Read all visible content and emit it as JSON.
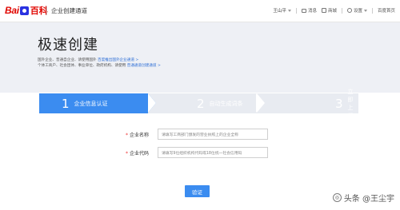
{
  "topbar": {
    "logo_text_bai": "Bai",
    "logo_text_du": "百科",
    "title": "企业创建通道",
    "user": "王山平",
    "links": [
      {
        "label": "消息",
        "icon": "message-icon"
      },
      {
        "label": "商城",
        "icon": "shop-icon"
      },
      {
        "label": "设置",
        "icon": "gear-icon"
      },
      {
        "label": "百度首页"
      }
    ]
  },
  "hero": {
    "title": "极速创建",
    "line1_text": "国外企业、普通自企业、请使用国外",
    "line1_link": "百度推出国外企业通道 >",
    "line2_text": "个体工商户、社会团体、事业单位、政府机构、请使用",
    "line2_link": "普通通道创建通道 >"
  },
  "steps": [
    {
      "num": "1",
      "label": "企业信息认证",
      "active": true
    },
    {
      "num": "2",
      "label": "自动生成词条",
      "active": false
    },
    {
      "num": "3",
      "label": "立即上线",
      "active": false
    }
  ],
  "form": {
    "name_label": "企业名称",
    "name_placeholder": "请填写工商部门颁发的营业执照上的企业全称",
    "code_label": "企业代码",
    "code_placeholder": "请填写9位组织机构代码或18位统一社会信用码",
    "submit_label": "验证"
  },
  "watermark": {
    "text": "头条 @王尘宇"
  },
  "colors": {
    "accent": "#3b8cf0",
    "hero_bg": "#eef0f5",
    "link": "#2f6fd6",
    "logo_red": "#e10601",
    "logo_blue": "#2932e1"
  }
}
